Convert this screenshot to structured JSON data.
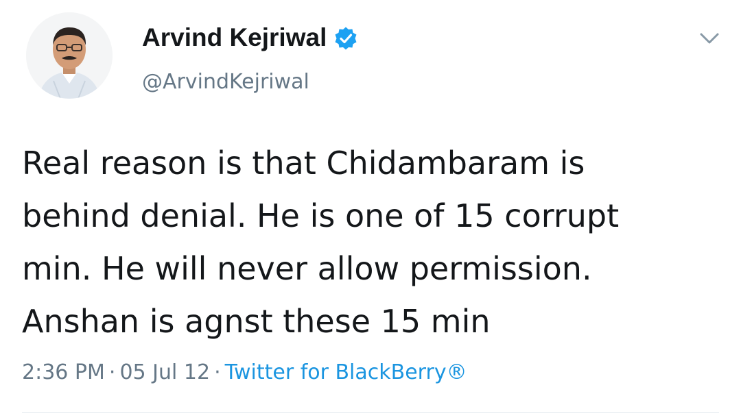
{
  "author": {
    "display_name": "Arvind Kejriwal",
    "handle": "@ArvindKejriwal",
    "verified": true,
    "avatar_icon": "profile-photo"
  },
  "tweet": {
    "lines": [
      "Real reason is that Chidambaram is",
      "behind denial. He is one of 15 corrupt",
      "min. He will never allow permission.",
      "Anshan is agnst these 15 min"
    ]
  },
  "meta": {
    "time": "2:36 PM",
    "separator": "·",
    "date": "05 Jul 12",
    "source": "Twitter for BlackBerry®"
  },
  "colors": {
    "text": "#14171a",
    "secondary": "#657786",
    "link": "#1b95e0",
    "verified_badge": "#1da1f2"
  }
}
